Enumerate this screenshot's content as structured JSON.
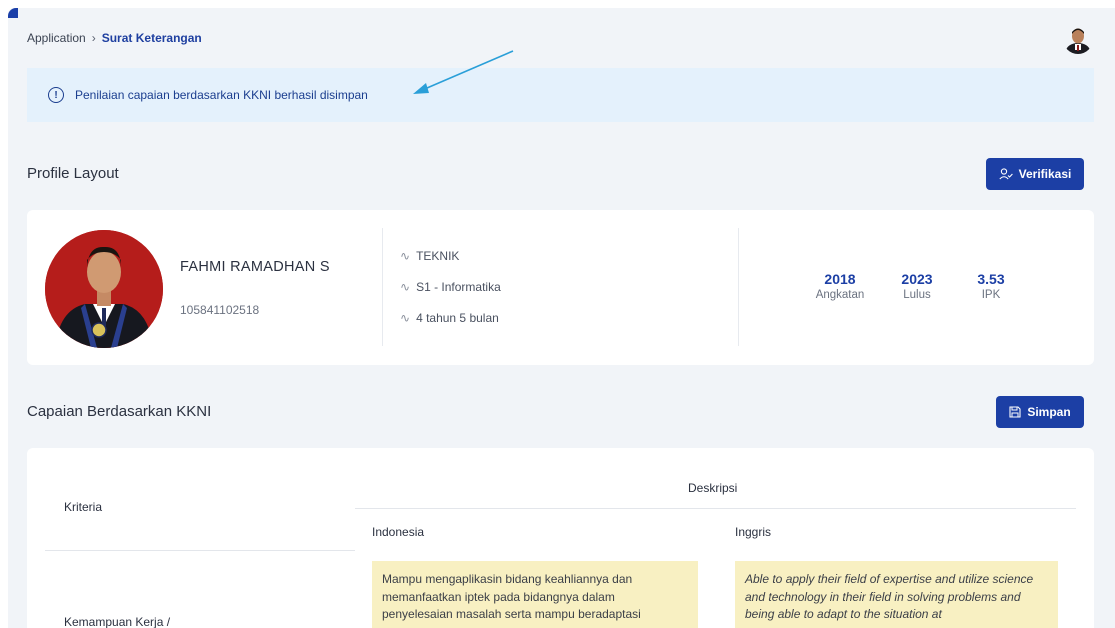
{
  "breadcrumb": {
    "parent": "Application",
    "separator": "›",
    "current": "Surat Keterangan"
  },
  "alert": {
    "icon": "info-circle-icon",
    "message": "Penilaian capaian berdasarkan KKNI berhasil disimpan"
  },
  "profile_section": {
    "title": "Profile Layout",
    "verify_button": "Verifikasi"
  },
  "profile": {
    "name": "FAHMI RAMADHAN S",
    "nim": "105841102518",
    "info": [
      {
        "icon": "pulse-icon",
        "text": "TEKNIK"
      },
      {
        "icon": "pulse-icon",
        "text": "S1 - Informatika"
      },
      {
        "icon": "pulse-icon",
        "text": "4 tahun 5 bulan"
      }
    ],
    "stats": [
      {
        "value": "2018",
        "label": "Angkatan"
      },
      {
        "value": "2023",
        "label": "Lulus"
      },
      {
        "value": "3.53",
        "label": "IPK"
      }
    ]
  },
  "kkni_section": {
    "title": "Capaian Berdasarkan KKNI",
    "save_button": "Simpan"
  },
  "table": {
    "header_kriteria": "Kriteria",
    "header_deskripsi": "Deskripsi",
    "header_indonesia": "Indonesia",
    "header_inggris": "Inggris",
    "rows": [
      {
        "kriteria": "Kemampuan Kerja /",
        "indonesia": "Mampu mengaplikasin bidang keahliannya dan memanfaatkan iptek pada bidangnya dalam penyelesaian masalah serta mampu beradaptasi",
        "inggris": "Able to apply their field of expertise and utilize science and technology in their field in solving problems and being able to adapt to the situation at"
      }
    ]
  },
  "colors": {
    "primary": "#1c3fa5",
    "alert_bg": "#e4f1fc",
    "alert_text": "#1b3e8f",
    "arrow": "#2a9fd8",
    "highlight": "#f8f0c2"
  }
}
